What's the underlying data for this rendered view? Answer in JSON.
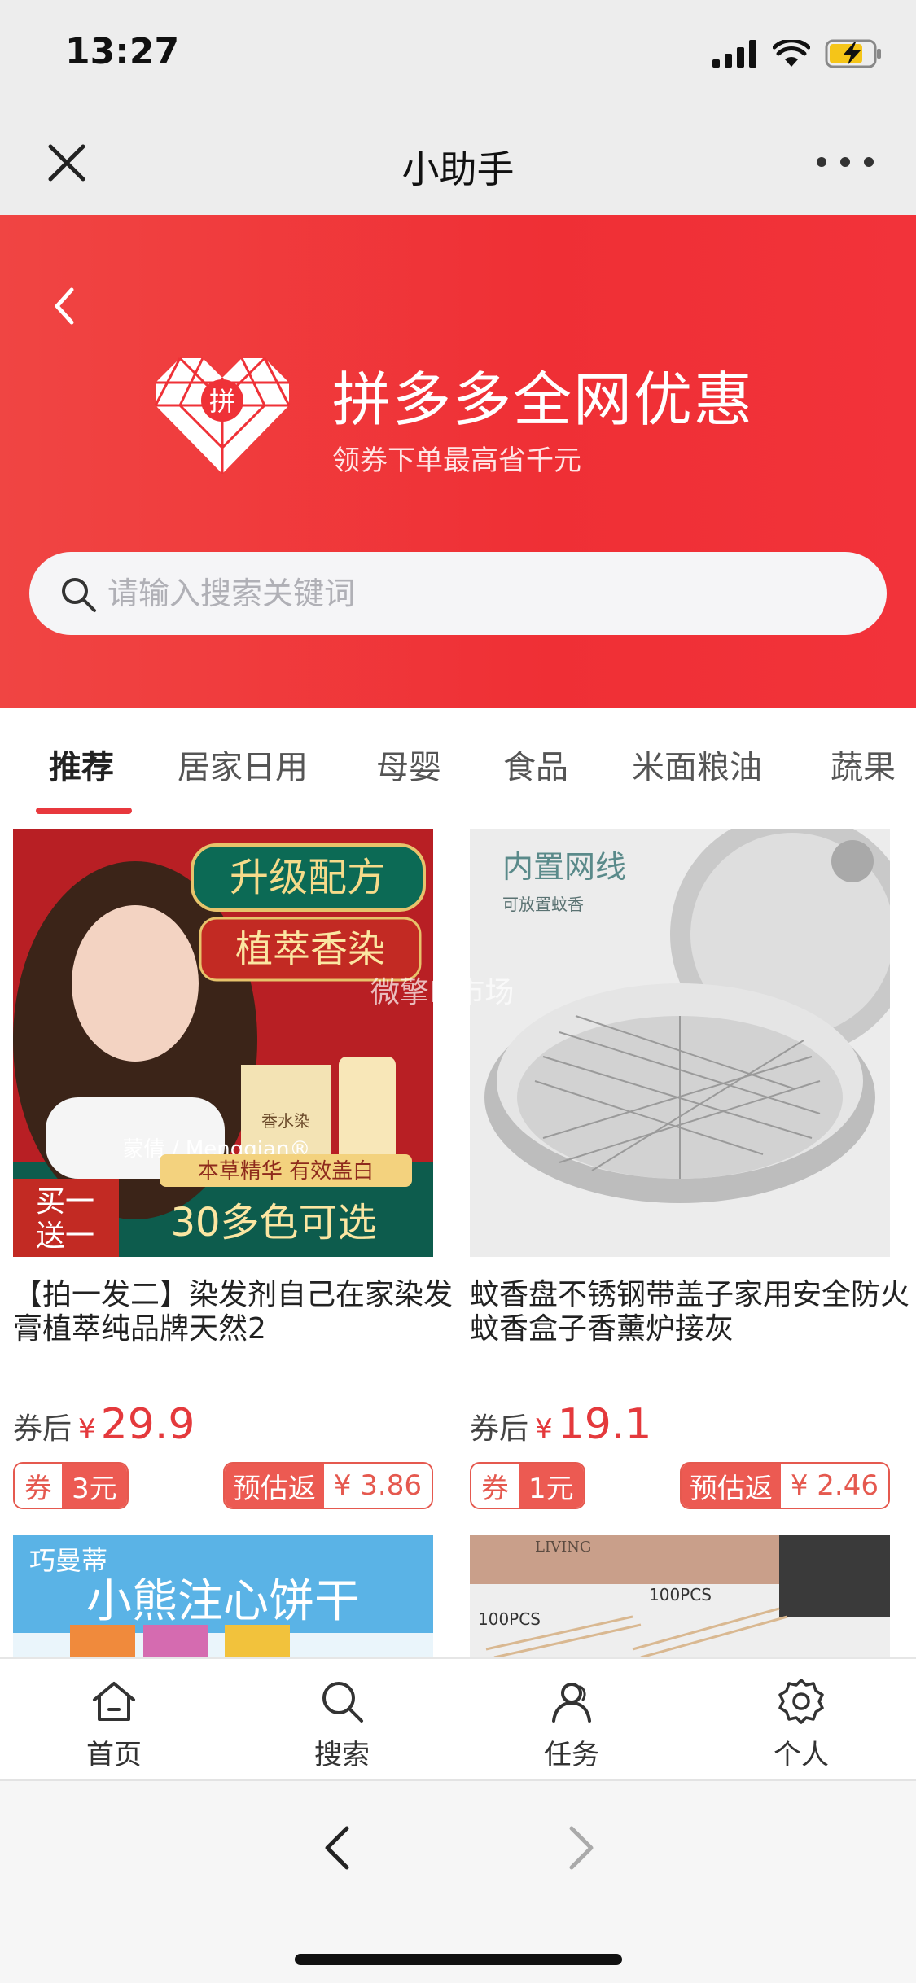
{
  "status_bar": {
    "time": "13:27"
  },
  "nav": {
    "title": "小助手"
  },
  "header": {
    "title": "拼多多全网优惠",
    "subtitle": "领券下单最高省千元",
    "logo_text": "拼",
    "search_placeholder": "请输入搜索关键词"
  },
  "tabs": [
    {
      "label": "推荐",
      "active": true
    },
    {
      "label": "居家日用"
    },
    {
      "label": "母婴"
    },
    {
      "label": "食品"
    },
    {
      "label": "米面粮油"
    },
    {
      "label": "蔬果"
    }
  ],
  "products": [
    {
      "name": "【拍一发二】染发剂自己在家染发膏植萃纯品牌天然2",
      "price_label": "券后",
      "currency": "¥",
      "price": "29.9",
      "coupon_tag": "券",
      "coupon_value": "3元",
      "rebate_label": "预估返",
      "rebate_value": "¥ 3.86",
      "image_text": [
        "升级配方",
        "植萃香染",
        "买一",
        "送一",
        "30多色可选",
        "本草精华 有效盖白",
        "香水染",
        "蒙倩 / Mengqian®"
      ]
    },
    {
      "name": "蚊香盘不锈钢带盖子家用安全防火蚊香盒子香薰炉接灰",
      "price_label": "券后",
      "currency": "¥",
      "price": "19.1",
      "coupon_tag": "券",
      "coupon_value": "1元",
      "rebate_label": "预估返",
      "rebate_value": "¥ 2.46",
      "image_text": [
        "内置网线",
        "可放置蚊香"
      ]
    }
  ],
  "thumbnails": [
    {
      "image_text": [
        "巧曼蒂",
        "小熊注心饼干"
      ]
    },
    {
      "image_text": [
        "LIVING",
        "100PCS",
        "100PCS"
      ]
    }
  ],
  "watermark": "微擎IP市场",
  "bottom_nav": [
    {
      "label": "首页",
      "icon": "home-icon"
    },
    {
      "label": "搜索",
      "icon": "search-icon"
    },
    {
      "label": "任务",
      "icon": "user-task-icon"
    },
    {
      "label": "个人",
      "icon": "gear-icon"
    }
  ],
  "colors": {
    "brand": "#ef2f35",
    "price": "#e4393c",
    "coupon": "#ec5a52"
  }
}
